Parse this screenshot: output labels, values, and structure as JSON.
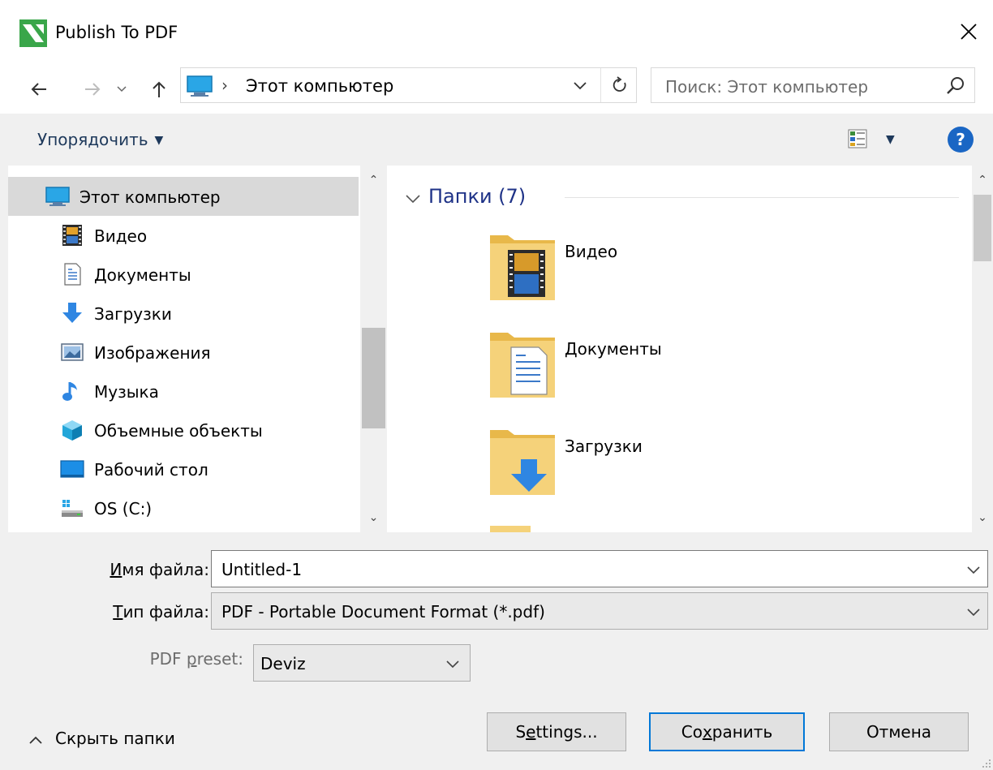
{
  "window": {
    "title": "Publish To PDF"
  },
  "navigation": {
    "address_sep": "›",
    "address": "Этот компьютер",
    "search_placeholder": "Поиск: Этот компьютер"
  },
  "toolbar": {
    "organize_label": "Упорядочить",
    "help_label": "?"
  },
  "sidebar": {
    "items": [
      {
        "label": "Этот компьютер",
        "icon": "computer-icon",
        "selected": true
      },
      {
        "label": "Видео",
        "icon": "video-icon"
      },
      {
        "label": "Документы",
        "icon": "documents-icon"
      },
      {
        "label": "Загрузки",
        "icon": "downloads-icon"
      },
      {
        "label": "Изображения",
        "icon": "pictures-icon"
      },
      {
        "label": "Музыка",
        "icon": "music-icon"
      },
      {
        "label": "Объемные объекты",
        "icon": "3d-objects-icon"
      },
      {
        "label": "Рабочий стол",
        "icon": "desktop-icon"
      },
      {
        "label": "OS (C:)",
        "icon": "drive-icon"
      }
    ]
  },
  "content": {
    "group_label": "Папки (7)",
    "folders": [
      {
        "label": "Видео",
        "icon": "video-folder-icon"
      },
      {
        "label": "Документы",
        "icon": "documents-folder-icon"
      },
      {
        "label": "Загрузки",
        "icon": "downloads-folder-icon"
      }
    ]
  },
  "form": {
    "filename_label_u": "И",
    "filename_label_rest": "мя файла:",
    "filename_value": "Untitled-1",
    "filetype_label_u": "Т",
    "filetype_label_rest": "ип файла:",
    "filetype_value": "PDF - Portable Document Format (*.pdf)",
    "preset_label_a": "PDF ",
    "preset_label_u": "p",
    "preset_label_b": "reset:",
    "preset_value": "Deviz"
  },
  "buttons": {
    "settings_a": "S",
    "settings_u": "e",
    "settings_b": "ttings...",
    "save_a": "Со",
    "save_u": "х",
    "save_b": "ранить",
    "cancel": "Отмена",
    "hide_folders": "Скрыть папки"
  },
  "colors": {
    "accent": "#0078d7",
    "link_blue": "#1e3287",
    "toolbar_bg": "#f0f0f0"
  }
}
